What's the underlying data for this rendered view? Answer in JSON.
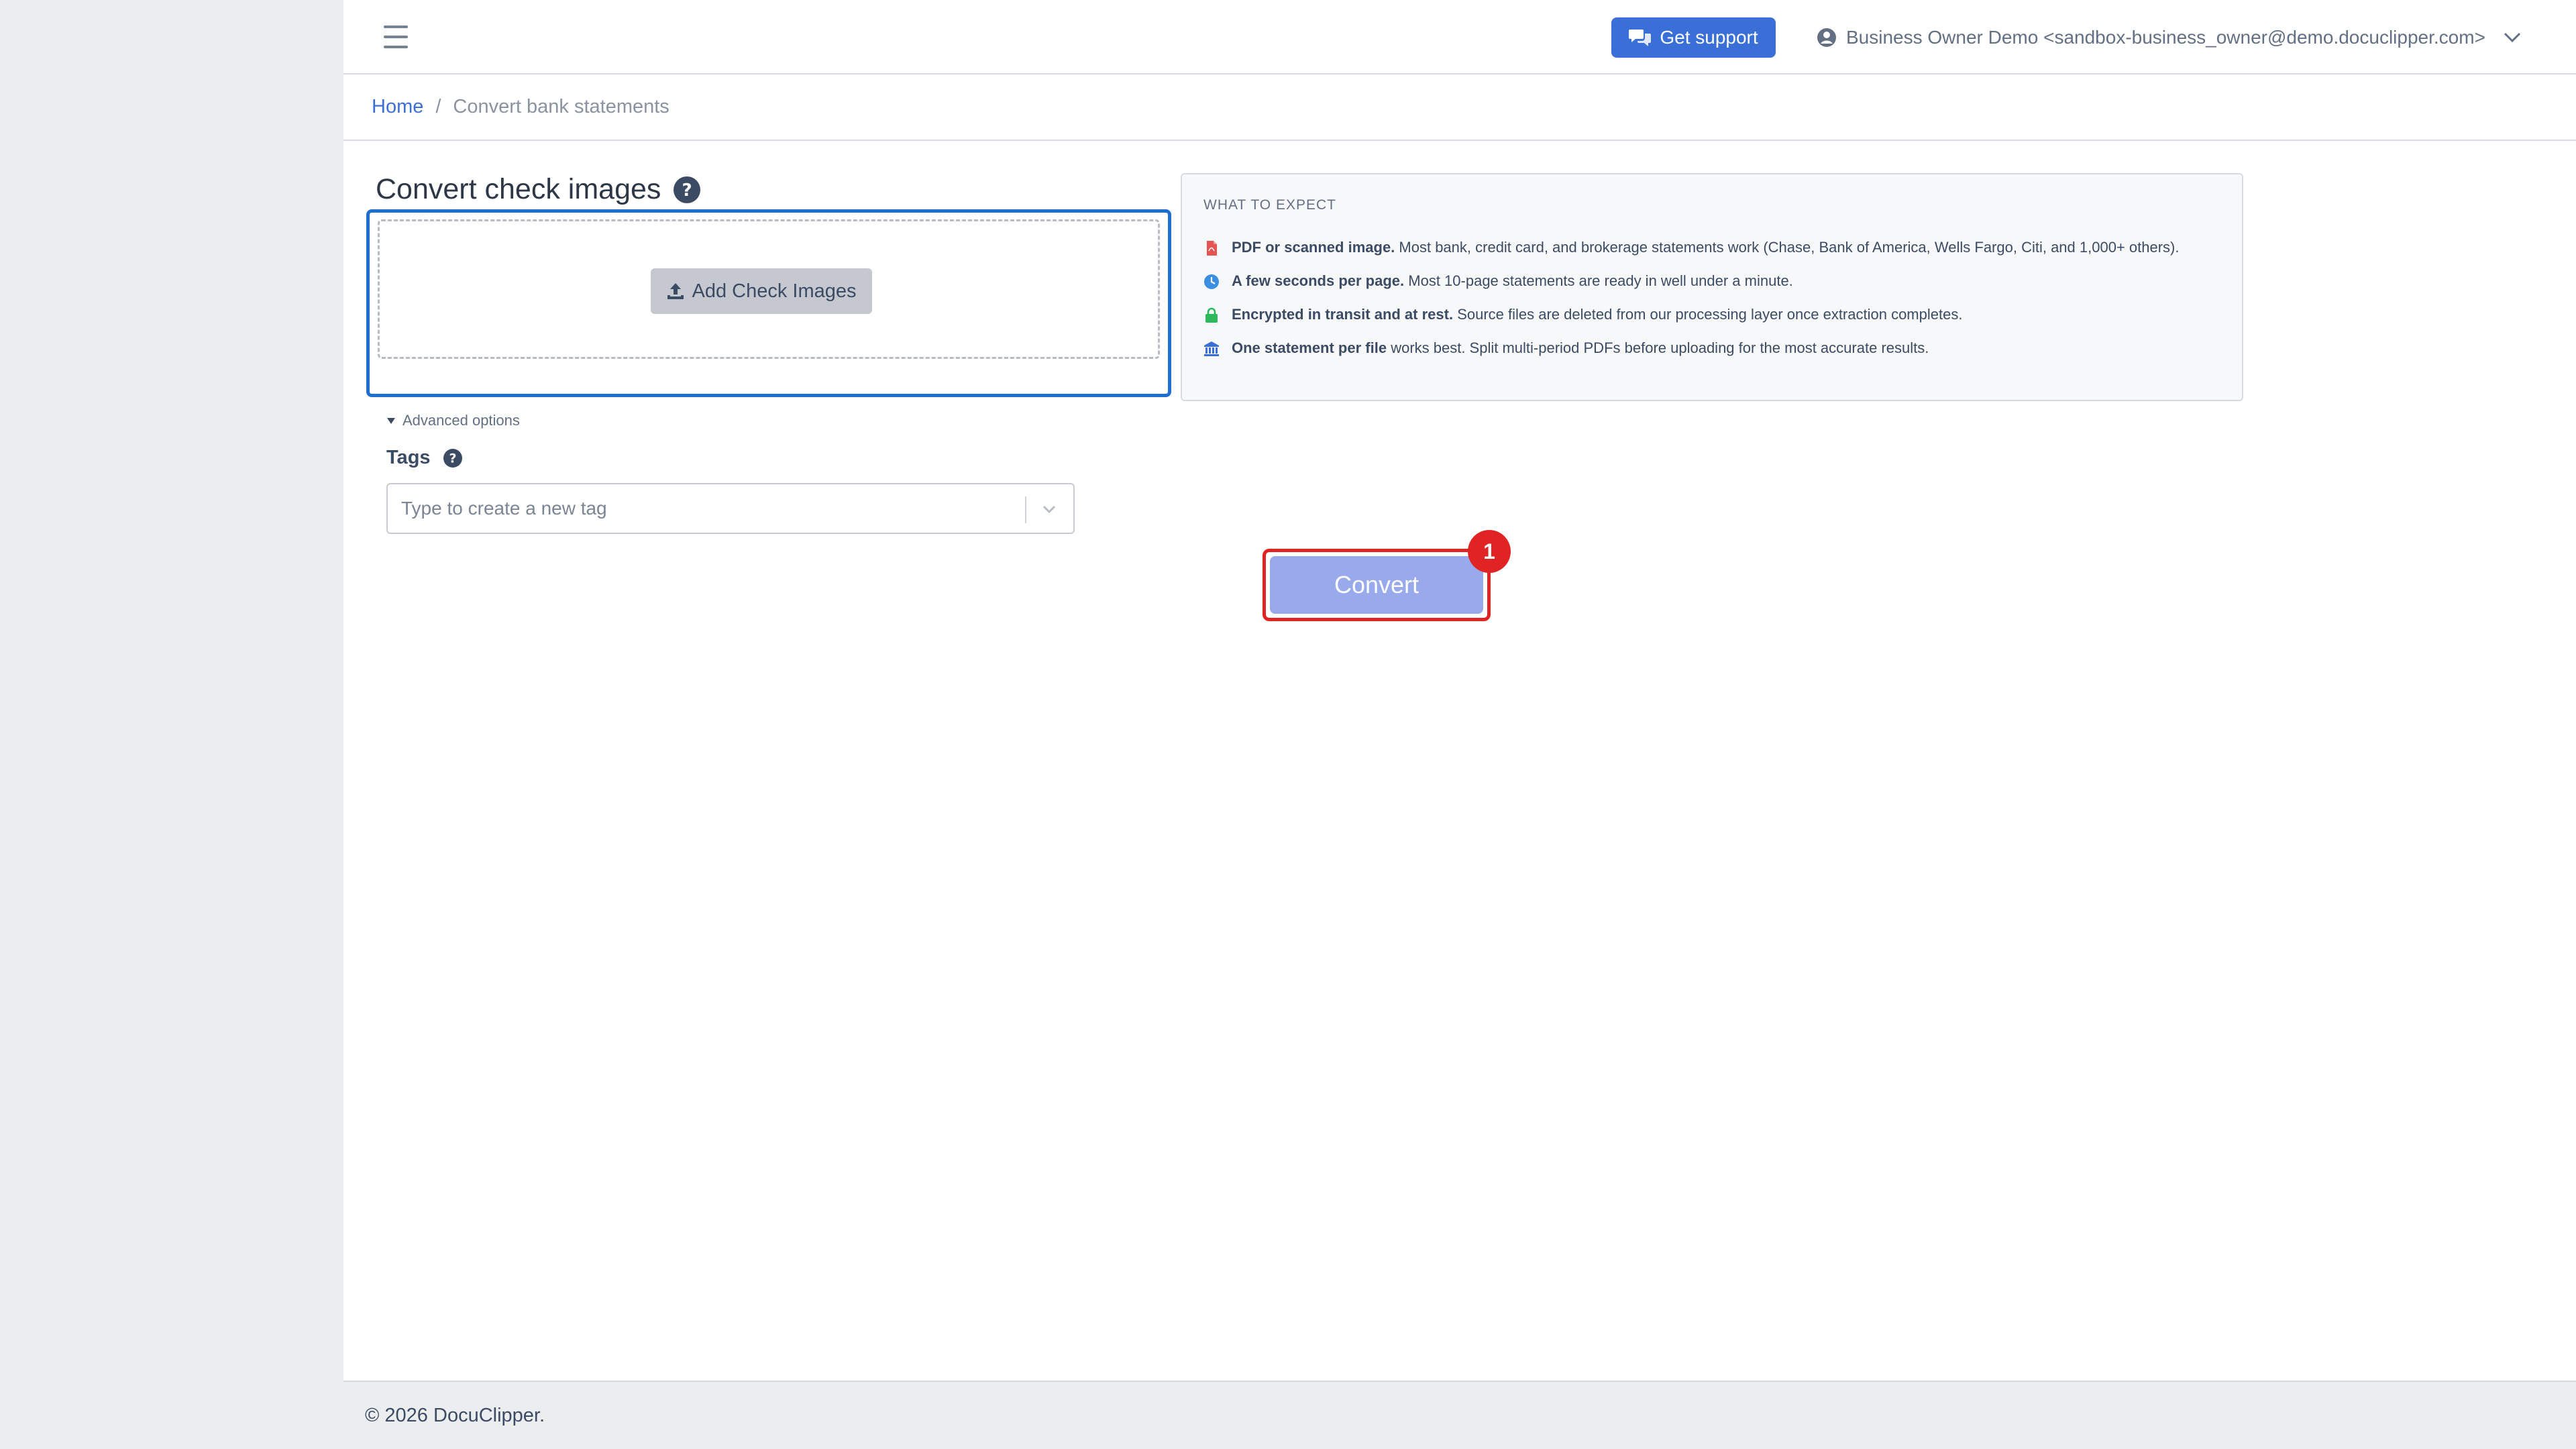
{
  "header": {
    "support_label": "Get support",
    "user_label": "Business Owner Demo <sandbox-business_owner@demo.docuclipper.com>"
  },
  "breadcrumb": {
    "home": "Home",
    "separator": "/",
    "current": "Convert bank statements"
  },
  "main": {
    "title": "Convert check images",
    "add_button_label": "Add Check Images",
    "advanced_options_label": "Advanced options",
    "tags_label": "Tags",
    "tags_placeholder": "Type to create a new tag",
    "convert_label": "Convert",
    "badge_count": "1"
  },
  "expect": {
    "title": "WHAT TO EXPECT",
    "items": [
      {
        "icon": "pdf-file-icon",
        "color": "#e55353",
        "bold": "PDF or scanned image.",
        "text": " Most bank, credit card, and brokerage statements work (Chase, Bank of America, Wells Fargo, Citi, and 1,000+ others)."
      },
      {
        "icon": "clock-icon",
        "color": "#3b8ee0",
        "bold": "A few seconds per page.",
        "text": " Most 10-page statements are ready in well under a minute."
      },
      {
        "icon": "lock-icon",
        "color": "#2eb85c",
        "bold": "Encrypted in transit and at rest.",
        "text": " Source files are deleted from our processing layer once extraction completes."
      },
      {
        "icon": "bank-icon",
        "color": "#3b6fd8",
        "bold": "One statement per file",
        "text": " works best. Split multi-period PDFs before uploading for the most accurate results."
      }
    ]
  },
  "footer": {
    "text": "© 2026 DocuClipper."
  },
  "colors": {
    "primary": "#3b6fd8",
    "focus": "#1f6fd1",
    "highlight": "#e02424",
    "convert_disabled": "#98a9ec"
  }
}
